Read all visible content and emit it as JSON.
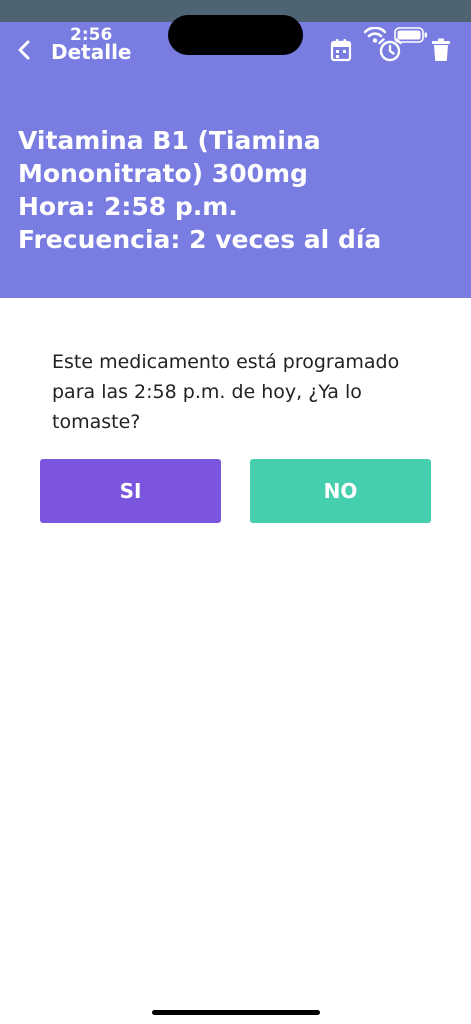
{
  "status_bar": {
    "time": "2:56"
  },
  "nav": {
    "title": "Detalle",
    "back_icon": "chevron-left-icon",
    "actions": [
      "calendar-icon",
      "alarm-clock-icon",
      "trash-icon"
    ]
  },
  "medication": {
    "name_line1": "Vitamina B1 (Tiamina",
    "name_line2": "Mononitrato) 300mg",
    "time_line": "Hora: 2:58 p.m.",
    "frequency_line": "Frecuencia: 2 veces al día"
  },
  "prompt": {
    "question": "Este medicamento está programado para las 2:58 p.m. de hoy, ¿Ya lo tomaste?"
  },
  "buttons": {
    "yes_label": "SI",
    "no_label": "NO"
  },
  "colors": {
    "header_bg": "#797ce1",
    "yes_button": "#7b55de",
    "no_button": "#45cfaf"
  }
}
